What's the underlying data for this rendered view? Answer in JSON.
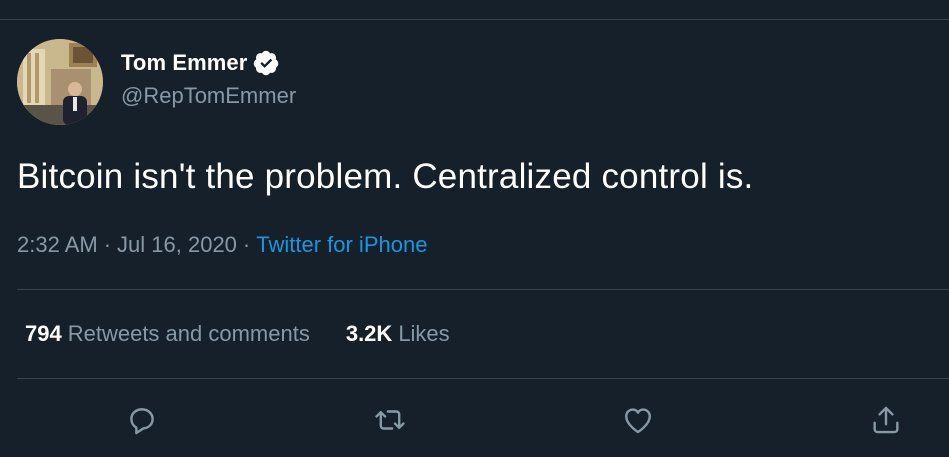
{
  "author": {
    "display_name": "Tom Emmer",
    "handle": "@RepTomEmmer",
    "verified": true,
    "avatar_icon": "profile-photo"
  },
  "tweet": {
    "text": "Bitcoin isn't the problem. Centralized control is.",
    "time": "2:32 AM",
    "date": "Jul 16, 2020",
    "separator": "·",
    "source": "Twitter for iPhone"
  },
  "stats": {
    "retweets_count": "794",
    "retweets_label": "Retweets and comments",
    "likes_count": "3.2K",
    "likes_label": "Likes"
  },
  "actions": {
    "reply_icon": "reply-icon",
    "retweet_icon": "retweet-icon",
    "like_icon": "heart-icon",
    "share_icon": "share-icon"
  },
  "colors": {
    "background": "#15202b",
    "secondary_text": "#8899a6",
    "link": "#1b95e0",
    "divider": "#38444d"
  }
}
